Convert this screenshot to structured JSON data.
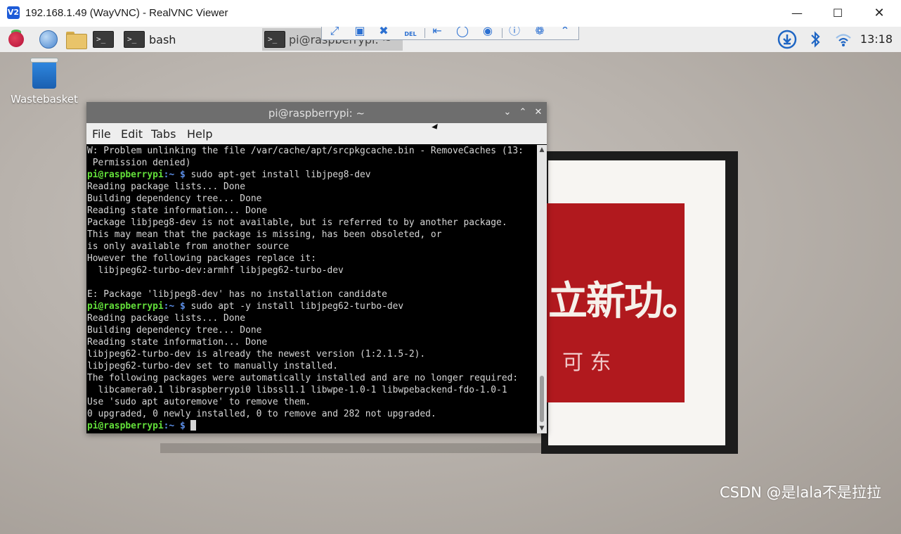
{
  "window": {
    "title": "192.168.1.49 (WayVNC) - RealVNC Viewer",
    "app_icon_glyph": "V2",
    "controls": [
      "minimize",
      "maximize",
      "close"
    ]
  },
  "panel": {
    "tasks": [
      {
        "label": "bash",
        "active": false
      },
      {
        "label": "pi@raspberrypi: ~",
        "active": true
      }
    ],
    "clock": "13:18",
    "tray": [
      "download-icon",
      "bluetooth-icon",
      "wifi-icon"
    ]
  },
  "vnc_toolbar": {
    "icons": [
      "fullscreen-icon",
      "scale-icon",
      "pin-icon",
      "ctrl-alt-del-icon",
      "transfer-icon",
      "chat-icon",
      "record-icon",
      "info-icon",
      "settings-icon",
      "close-toolbar-icon"
    ],
    "del_label": "DEL"
  },
  "desktop": {
    "wastebasket_label": "Wastebasket",
    "artwork_text": "立新功。",
    "artwork_signature": "可 东"
  },
  "terminal": {
    "title": "pi@raspberrypi: ~",
    "menu": [
      "File",
      "Edit",
      "Tabs",
      "Help"
    ],
    "prompt_user": "pi@raspberrypi",
    "prompt_path": ":~ $",
    "lines": [
      {
        "type": "out",
        "text": "W: Problem unlinking the file /var/cache/apt/srcpkgcache.bin - RemoveCaches (13:"
      },
      {
        "type": "out",
        "text": " Permission denied)"
      },
      {
        "type": "cmd",
        "text": " sudo apt-get install libjpeg8-dev"
      },
      {
        "type": "out",
        "text": "Reading package lists... Done"
      },
      {
        "type": "out",
        "text": "Building dependency tree... Done"
      },
      {
        "type": "out",
        "text": "Reading state information... Done"
      },
      {
        "type": "out",
        "text": "Package libjpeg8-dev is not available, but is referred to by another package."
      },
      {
        "type": "out",
        "text": "This may mean that the package is missing, has been obsoleted, or"
      },
      {
        "type": "out",
        "text": "is only available from another source"
      },
      {
        "type": "out",
        "text": "However the following packages replace it:"
      },
      {
        "type": "out",
        "text": "  libjpeg62-turbo-dev:armhf libjpeg62-turbo-dev"
      },
      {
        "type": "out",
        "text": ""
      },
      {
        "type": "out",
        "text": "E: Package 'libjpeg8-dev' has no installation candidate"
      },
      {
        "type": "cmd",
        "text": " sudo apt -y install libjpeg62-turbo-dev"
      },
      {
        "type": "out",
        "text": "Reading package lists... Done"
      },
      {
        "type": "out",
        "text": "Building dependency tree... Done"
      },
      {
        "type": "out",
        "text": "Reading state information... Done"
      },
      {
        "type": "out",
        "text": "libjpeg62-turbo-dev is already the newest version (1:2.1.5-2)."
      },
      {
        "type": "out",
        "text": "libjpeg62-turbo-dev set to manually installed."
      },
      {
        "type": "out",
        "text": "The following packages were automatically installed and are no longer required:"
      },
      {
        "type": "out",
        "text": "  libcamera0.1 libraspberrypi0 libssl1.1 libwpe-1.0-1 libwpebackend-fdo-1.0-1"
      },
      {
        "type": "out",
        "text": "Use 'sudo apt autoremove' to remove them."
      },
      {
        "type": "out",
        "text": "0 upgraded, 0 newly installed, 0 to remove and 282 not upgraded."
      },
      {
        "type": "prompt",
        "text": " "
      }
    ]
  },
  "watermark": "CSDN @是lala不是拉拉"
}
